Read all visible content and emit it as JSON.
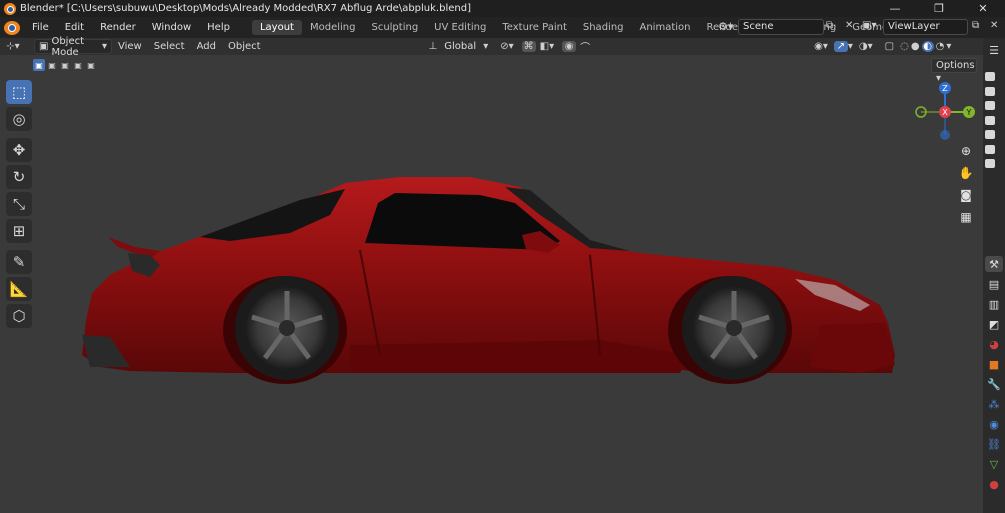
{
  "window": {
    "title": "Blender* [C:\\Users\\subuwu\\Desktop\\Mods\\Already Modded\\RX7 Abflug Arde\\abpluk.blend]",
    "controls": [
      "—",
      "❐",
      "✕"
    ]
  },
  "menubar": {
    "items": [
      "File",
      "Edit",
      "Render",
      "Window",
      "Help"
    ],
    "tabs": [
      "Layout",
      "Modeling",
      "Sculpting",
      "UV Editing",
      "Texture Paint",
      "Shading",
      "Animation",
      "Rendering",
      "Compositing",
      "Geometry Noc"
    ],
    "active_tab": "Layout",
    "scene": "Scene",
    "view_layer": "ViewLayer"
  },
  "header": {
    "mode": "Object Mode",
    "menus": [
      "View",
      "Select",
      "Add",
      "Object"
    ],
    "transform_orientation": "Global"
  },
  "viewport": {
    "options_label": "Options",
    "gizmo": {
      "z": "Z",
      "y": "Y",
      "x": "X"
    }
  },
  "colors": {
    "accent": "#4772b3",
    "car_red": "#8e0f10",
    "gizmo_z": "#2f6fd1",
    "gizmo_y": "#82b52a",
    "gizmo_x": "#e0404f"
  }
}
